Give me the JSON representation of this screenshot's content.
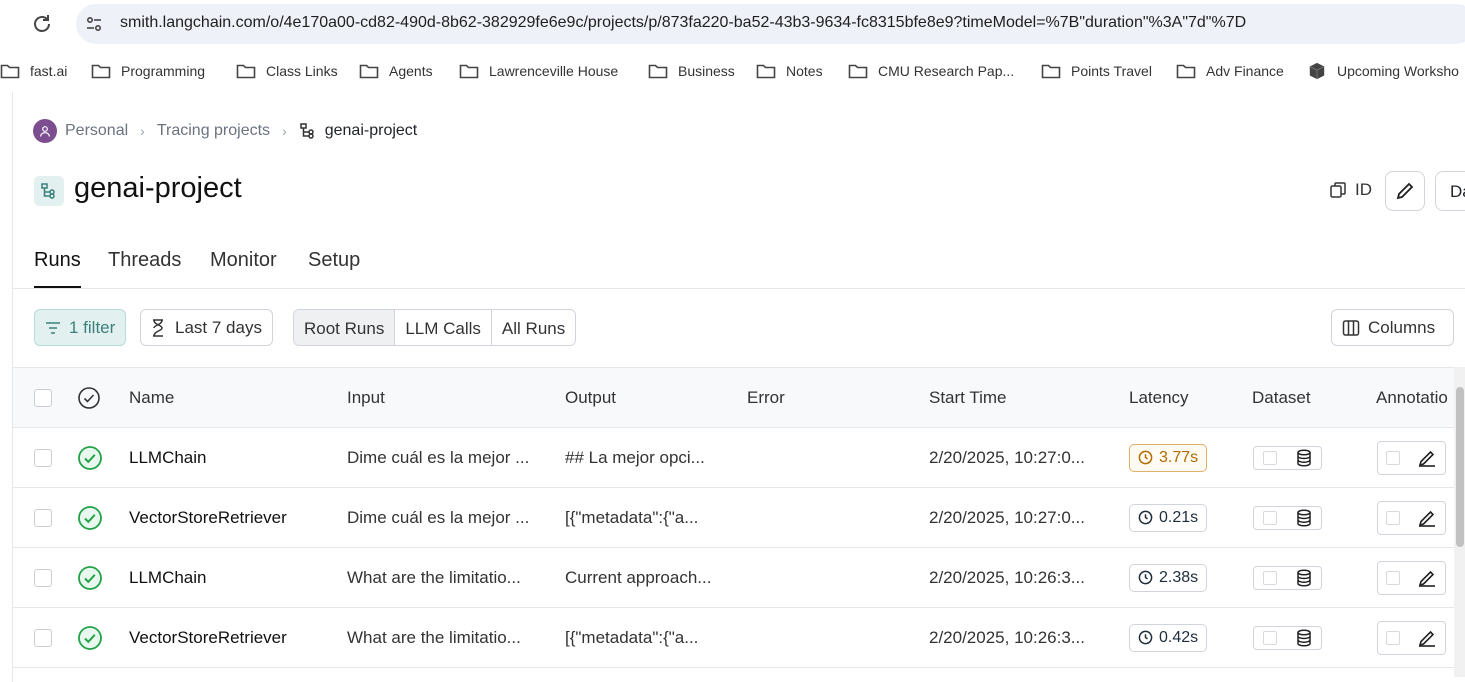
{
  "browser": {
    "url": "smith.langchain.com/o/4e170a00-cd82-490d-8b62-382929fe6e9c/projects/p/873fa220-ba52-43b3-9634-fc8315bfe8e9?timeModel=%7B\"duration\"%3A\"7d\"%7D"
  },
  "bookmarks": [
    {
      "label": "fast.ai"
    },
    {
      "label": "Programming"
    },
    {
      "label": "Class Links"
    },
    {
      "label": "Agents"
    },
    {
      "label": "Lawrenceville House"
    },
    {
      "label": "Business"
    },
    {
      "label": "Notes"
    },
    {
      "label": "CMU Research Pap..."
    },
    {
      "label": "Points Travel"
    },
    {
      "label": "Adv Finance"
    },
    {
      "label": "Upcoming Worksho"
    }
  ],
  "breadcrumb": {
    "workspace": "Personal",
    "section": "Tracing projects",
    "current": "genai-project"
  },
  "header": {
    "title": "genai-project",
    "id_label": "ID",
    "d_label": "Da"
  },
  "tabs": [
    "Runs",
    "Threads",
    "Monitor",
    "Setup"
  ],
  "toolbar": {
    "filter_label": "1 filter",
    "time_label": "Last 7 days",
    "run_types": [
      "Root Runs",
      "LLM Calls",
      "All Runs"
    ],
    "columns_label": "Columns"
  },
  "table": {
    "headers": {
      "name": "Name",
      "input": "Input",
      "output": "Output",
      "error": "Error",
      "start": "Start Time",
      "latency": "Latency",
      "dataset": "Dataset",
      "annotation": "Annotatio"
    },
    "rows": [
      {
        "name": "LLMChain",
        "input": "Dime cuál es la mejor ...",
        "output": "## La mejor opci...",
        "error": "",
        "start": "2/20/2025, 10:27:0...",
        "latency": "3.77s",
        "latency_warn": true
      },
      {
        "name": "VectorStoreRetriever",
        "input": "Dime cuál es la mejor ...",
        "output": "[{\"metadata\":{\"a...",
        "error": "",
        "start": "2/20/2025, 10:27:0...",
        "latency": "0.21s",
        "latency_warn": false
      },
      {
        "name": "LLMChain",
        "input": "What are the limitatio...",
        "output": "Current approach...",
        "error": "",
        "start": "2/20/2025, 10:26:3...",
        "latency": "2.38s",
        "latency_warn": false
      },
      {
        "name": "VectorStoreRetriever",
        "input": "What are the limitatio...",
        "output": "[{\"metadata\":{\"a...",
        "error": "",
        "start": "2/20/2025, 10:26:3...",
        "latency": "0.42s",
        "latency_warn": false
      }
    ]
  },
  "colors": {
    "accent": "#3a7f7a",
    "success": "#22a34a",
    "warn": "#b26b00"
  }
}
